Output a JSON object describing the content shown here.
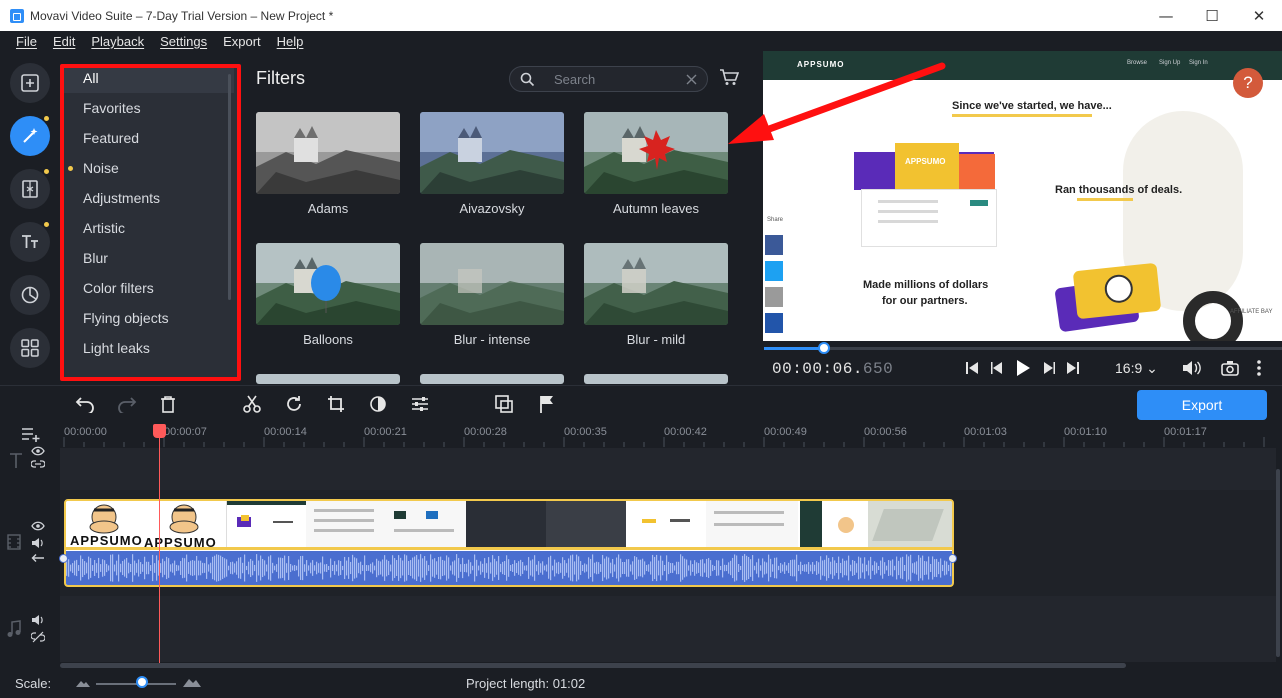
{
  "window": {
    "title": "Movavi Video Suite – 7-Day Trial Version – New Project *",
    "min": "—",
    "max": "☐",
    "close": "✕"
  },
  "menu": [
    "File",
    "Edit",
    "Playback",
    "Settings",
    "Export",
    "Help"
  ],
  "categories": [
    {
      "label": "All",
      "active": true,
      "dot": false
    },
    {
      "label": "Favorites",
      "active": false,
      "dot": false
    },
    {
      "label": "Featured",
      "active": false,
      "dot": false
    },
    {
      "label": "Noise",
      "active": false,
      "dot": true
    },
    {
      "label": "Adjustments",
      "active": false,
      "dot": false
    },
    {
      "label": "Artistic",
      "active": false,
      "dot": false
    },
    {
      "label": "Blur",
      "active": false,
      "dot": false
    },
    {
      "label": "Color filters",
      "active": false,
      "dot": false
    },
    {
      "label": "Flying objects",
      "active": false,
      "dot": false
    },
    {
      "label": "Light leaks",
      "active": false,
      "dot": false
    }
  ],
  "filters": {
    "title": "Filters",
    "search_placeholder": "Search",
    "items": [
      "Adams",
      "Aivazovsky",
      "Autumn leaves",
      "Balloons",
      "Blur - intense",
      "Blur - mild"
    ]
  },
  "preview": {
    "brand": "APPSUMO",
    "nav": [
      "Browse",
      "Sign Up",
      "Sign In"
    ],
    "headline": "Since we've started, we have...",
    "card_brand": "APPSUMO",
    "stat1": "Ran thousands of deals.",
    "stat2_line1": "Made millions of dollars",
    "stat2_line2": "for our partners.",
    "share_label": "Share",
    "help_glyph": "?",
    "footer_text": "AFFILIATE BAY",
    "time_main": "00:00:06.",
    "time_frac": "650",
    "aspect": "16:9 ⌄"
  },
  "timeline": {
    "export_label": "Export",
    "ticks": [
      "00:00:00",
      "00:00:07",
      "00:00:14",
      "00:00:21",
      "00:00:28",
      "00:00:35",
      "00:00:42",
      "00:00:49",
      "00:00:56",
      "00:01:03",
      "00:01:10",
      "00:01:17"
    ],
    "clip_brand_1": "APPSUMO",
    "clip_brand_2": "APPSUMO"
  },
  "status": {
    "scale_label": "Scale:",
    "project_length": "Project length:  01:02"
  },
  "colors": {
    "accent": "#2e8ef7",
    "highlight": "#ff1010",
    "clip_border": "#f2c94c"
  }
}
